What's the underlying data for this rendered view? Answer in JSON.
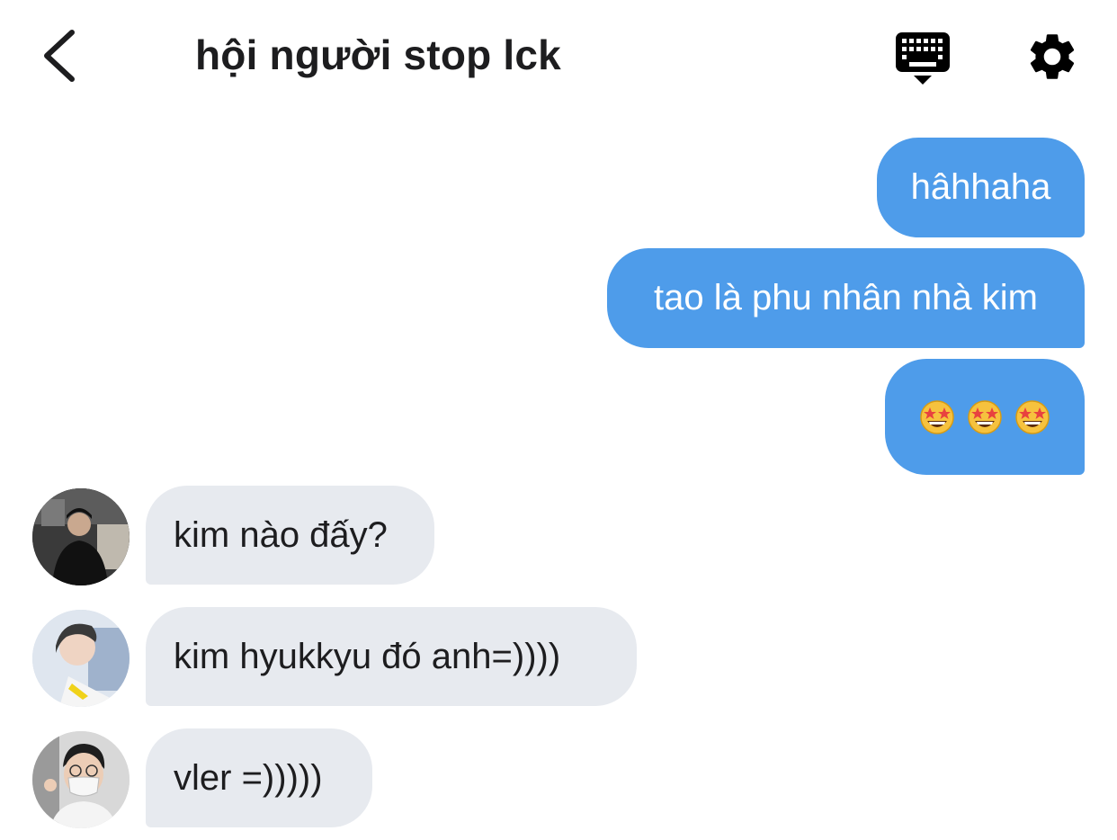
{
  "header": {
    "title": "hội người stop lck",
    "back_icon": "chevron-left-icon",
    "keyboard_icon": "keyboard-icon",
    "settings_icon": "gear-icon"
  },
  "messages_outgoing": [
    {
      "text": "hâhhaha"
    },
    {
      "text": "tao là phu nhân nhà kim"
    },
    {
      "emoji": [
        "star-struck-emoji",
        "star-struck-emoji",
        "star-struck-emoji"
      ]
    }
  ],
  "messages_incoming": [
    {
      "text": "kim nào đấy?",
      "avatar": "user-avatar-1"
    },
    {
      "text": "kim hyukkyu đó anh=))))",
      "avatar": "user-avatar-2"
    },
    {
      "text": "vler =)))))",
      "avatar": "user-avatar-3"
    }
  ],
  "colors": {
    "outgoing_bubble": "#4e9cea",
    "incoming_bubble": "#e7eaef",
    "text_dark": "#1d1d1f",
    "background": "#ffffff"
  }
}
